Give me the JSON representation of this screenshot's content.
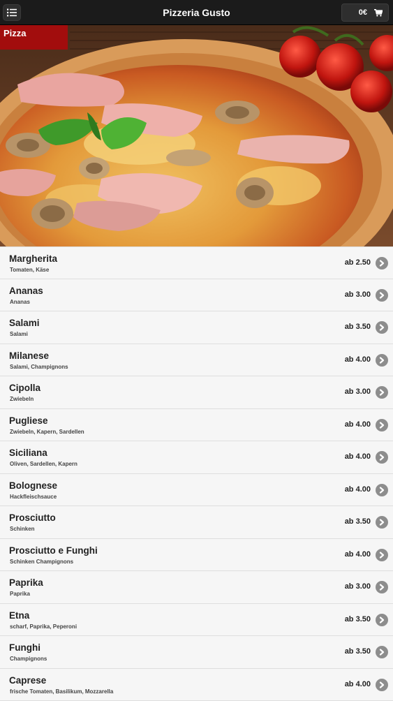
{
  "header": {
    "title": "Pizzeria Gusto",
    "cart_total": "0€",
    "menu_icon": "list-icon",
    "cart_icon": "cart-icon"
  },
  "category": {
    "label": "Pizza"
  },
  "items": [
    {
      "name": "Margherita",
      "desc": "Tomaten, Käse",
      "price": "ab 2.50"
    },
    {
      "name": "Ananas",
      "desc": "Ananas",
      "price": "ab 3.00"
    },
    {
      "name": "Salami",
      "desc": "Salami",
      "price": "ab 3.50"
    },
    {
      "name": "Milanese",
      "desc": "Salami, Champignons",
      "price": "ab 4.00"
    },
    {
      "name": "Cipolla",
      "desc": "Zwiebeln",
      "price": "ab 3.00"
    },
    {
      "name": "Pugliese",
      "desc": "Zwiebeln, Kapern, Sardellen",
      "price": "ab 4.00"
    },
    {
      "name": "Siciliana",
      "desc": "Oliven, Sardellen, Kapern",
      "price": "ab 4.00"
    },
    {
      "name": "Bolognese",
      "desc": "Hackfleischsauce",
      "price": "ab 4.00"
    },
    {
      "name": "Prosciutto",
      "desc": "Schinken",
      "price": "ab 3.50"
    },
    {
      "name": "Prosciutto e Funghi",
      "desc": "Schinken Champignons",
      "price": "ab 4.00"
    },
    {
      "name": "Paprika",
      "desc": "Paprika",
      "price": "ab 3.00"
    },
    {
      "name": "Etna",
      "desc": "scharf, Paprika, Peperoni",
      "price": "ab 3.50"
    },
    {
      "name": "Funghi",
      "desc": "Champignons",
      "price": "ab 3.50"
    },
    {
      "name": "Caprese",
      "desc": "frische Tomaten, Basilikum, Mozzarella",
      "price": "ab 4.00"
    }
  ],
  "colors": {
    "header_bg": "#1b1b1b",
    "accent_red": "#a20d0d",
    "arrow_grey": "#8d8d8d"
  }
}
